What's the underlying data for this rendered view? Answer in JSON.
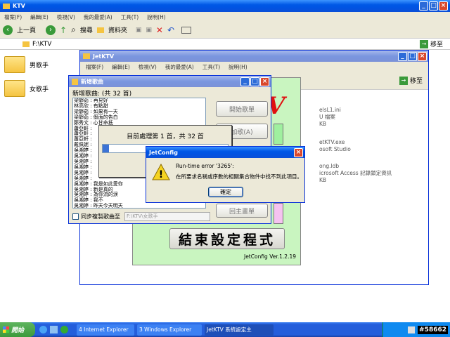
{
  "explorer": {
    "title": "KTV",
    "menu": [
      "檔案(F)",
      "編輯(E)",
      "檢視(V)",
      "我的最愛(A)",
      "工具(T)",
      "說明(H)"
    ],
    "back": "上一頁",
    "search": "搜尋",
    "folders": "資料夾",
    "address": "F:\\KTV",
    "go": "移至",
    "items": [
      "男歌手",
      "女歌手"
    ]
  },
  "jetktv": {
    "title": "JetKTV",
    "menu": [
      "檔案(F)",
      "編輯(E)",
      "檢視(V)",
      "我的最愛(A)",
      "工具(T)",
      "說明(H)"
    ],
    "go": "移至",
    "files": [
      "elsL1.ini",
      "U 檔案",
      "KB",
      "etKTV.exe",
      "osoft Studio",
      "ong.ldb",
      "icrosoft Access 記錄鎖定資訊",
      "KB"
    ],
    "end_button": "結束設定程式",
    "version": "JetConfig Ver.1.2.19",
    "red_text": "V"
  },
  "newsong": {
    "title": "新增歌曲",
    "count_label": "新增歌曲: (共 32 首)",
    "songs": [
      "梁靜茹 : 再見好",
      "林高欣 : 有點甜",
      "梁靜茹 : 如果有一天",
      "梁靜茹 : 假面的告白",
      "鄭秀文 : 心甘命抵",
      "蕭亞軒 : ",
      "蕭亞軒 : ",
      "蕭亞軒 : ",
      "戴佩妮 : ",
      "吳湘婷 : ",
      "吳湘婷 : ",
      "吳湘婷 : ",
      "吳湘婷 : ",
      "吳湘婷 : ",
      "吳湘婷 : ",
      "吳湘婷 : 我是如此愛你",
      "吳湘婷 : 新是真的",
      "吳湘婷 : 為你流的淚",
      "吳湘婷 : 我不",
      "吳湘婷 : 昨天今天明天"
    ],
    "btn_start": "開始歌單",
    "btn_add": "加歌(A)",
    "btn_back": "回主畫單",
    "sync_label": "同步複製歌曲至",
    "sync_path": "F:\\KTV\\女歌手"
  },
  "progress": {
    "text": "目前處理第 1 首，共 32 首",
    "level": 0.05
  },
  "error": {
    "title": "JetConfig",
    "line1": "Run-time error '3265':",
    "line2": "在所要求名稱或序數的相關集合物件中找不到此項目。",
    "ok": "確定"
  },
  "taskbar": {
    "start": "開始",
    "tasks": [
      "4 Internet Explorer",
      "3 Windows Explorer",
      "JetKTV 系統設定主"
    ],
    "tag": "#58662"
  }
}
